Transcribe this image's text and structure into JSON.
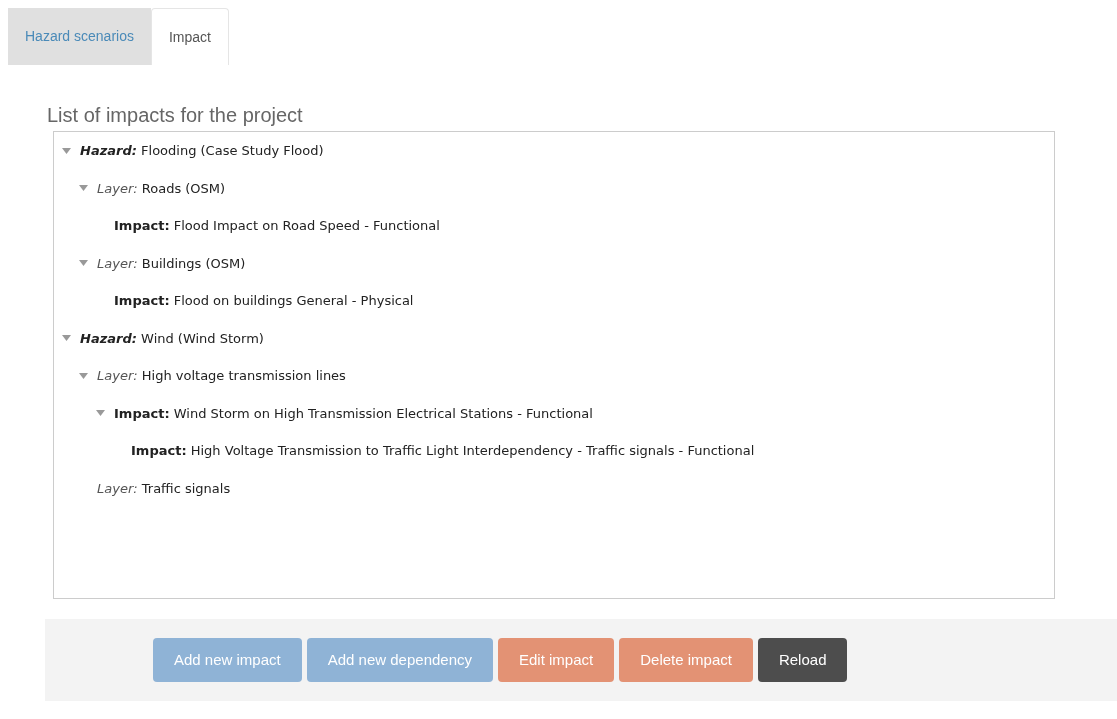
{
  "tabs": [
    {
      "label": "Hazard scenarios",
      "selected": false
    },
    {
      "label": "Impact",
      "selected": true
    }
  ],
  "title": "List of impacts for the project",
  "tree": [
    {
      "kind": "hazard",
      "prefix": "Hazard:",
      "text": "Flooding (Case Study Flood)",
      "expanded": true,
      "children": [
        {
          "kind": "layer",
          "prefix": "Layer:",
          "text": "Roads (OSM)",
          "expanded": true,
          "children": [
            {
              "kind": "impact",
              "prefix": "Impact:",
              "text": "Flood Impact on Road Speed - Functional"
            }
          ]
        },
        {
          "kind": "layer",
          "prefix": "Layer:",
          "text": "Buildings (OSM)",
          "expanded": true,
          "children": [
            {
              "kind": "impact",
              "prefix": "Impact:",
              "text": "Flood on buildings General - Physical"
            }
          ]
        }
      ]
    },
    {
      "kind": "hazard",
      "prefix": "Hazard:",
      "text": "Wind (Wind Storm)",
      "expanded": true,
      "children": [
        {
          "kind": "layer",
          "prefix": "Layer:",
          "text": "High voltage transmission lines",
          "expanded": true,
          "children": [
            {
              "kind": "impact",
              "prefix": "Impact:",
              "text": "Wind Storm on High Transmission Electrical Stations - Functional",
              "expanded": true,
              "children": [
                {
                  "kind": "impact",
                  "prefix": "Impact:",
                  "text": "High Voltage Transmission to Traffic Light Interdependency - Traffic signals - Functional"
                }
              ]
            }
          ]
        },
        {
          "kind": "layer",
          "prefix": "Layer:",
          "text": "Traffic signals"
        }
      ]
    }
  ],
  "buttons": [
    {
      "label": "Add new impact",
      "kind": "primary"
    },
    {
      "label": "Add new dependency",
      "kind": "primary"
    },
    {
      "label": "Edit impact",
      "kind": "warning"
    },
    {
      "label": "Delete impact",
      "kind": "warning"
    },
    {
      "label": "Reload",
      "kind": "dark"
    }
  ]
}
